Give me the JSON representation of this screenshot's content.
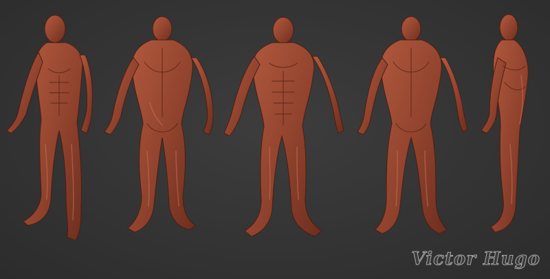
{
  "image": {
    "subject": "ecorche",
    "background_color": "#343434",
    "figure_color": "#9a4a33",
    "views": [
      "three-quarter-front",
      "back",
      "front",
      "back",
      "side"
    ]
  },
  "watermark": {
    "text": "Victor Hugo"
  }
}
